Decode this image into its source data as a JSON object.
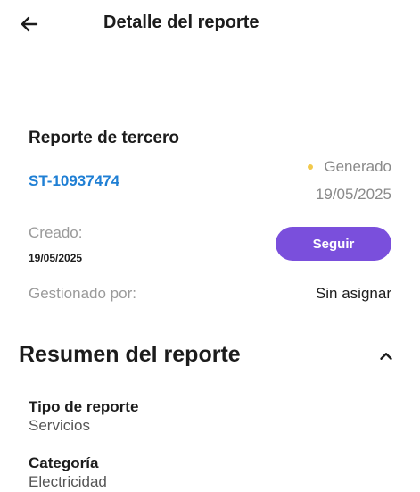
{
  "header": {
    "title": "Detalle del reporte",
    "back_icon": "arrow-left-icon"
  },
  "report": {
    "card_title": "Reporte de tercero",
    "id": "ST-10937474",
    "status": {
      "label": "Generado",
      "date": "19/05/2025",
      "color": "#f2c94c"
    },
    "created": {
      "label": "Creado:",
      "date": "19/05/2025"
    },
    "follow_button": {
      "label": "Seguir",
      "color": "#7a4fdc"
    },
    "managed_by": {
      "label": "Gestionado por:",
      "value": "Sin asignar"
    },
    "id_color": "#1f7fd4"
  },
  "summary": {
    "title": "Resumen del reporte",
    "chevron_icon": "chevron-up-icon",
    "fields": [
      {
        "label": "Tipo de reporte",
        "value": "Servicios"
      },
      {
        "label": "Categoría",
        "value": "Electricidad"
      }
    ]
  }
}
